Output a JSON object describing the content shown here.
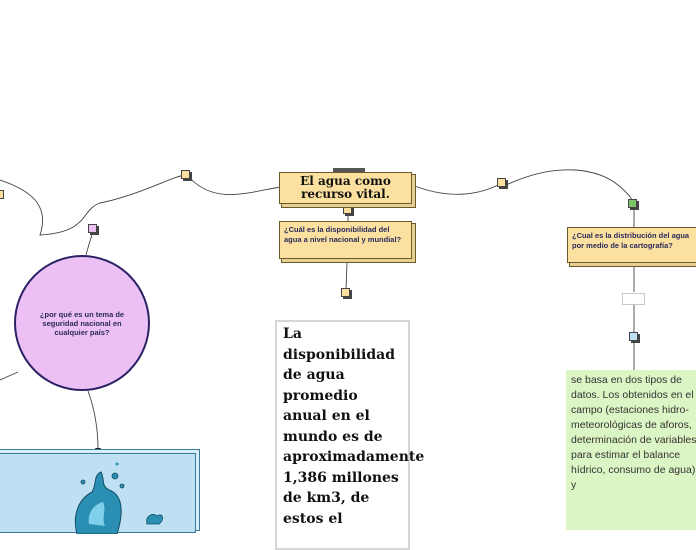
{
  "central_topic": {
    "label": "El agua como recurso vital."
  },
  "question_nodes": {
    "availability": "¿Cuál es la disponibilidad del agua a nivel nacional y mundial?",
    "distribution": "¿Cual es la distribución del agua por medio de la cartografía?",
    "security": "¿por qué es un tema de seguridad nacional en cualquier país?"
  },
  "detail_texts": {
    "availability_answer": "La disponibilidad de agua promedio anual en el mundo es de aproximadamente 1,386 millones de km3, de estos el",
    "distribution_answer": "se basa en dos tipos de datos. Los obtenidos en el campo (estaciones hidro-meteorológicas de aforos, determinación de variables para estimar el balance hídrico, consumo de agua), y"
  },
  "colors": {
    "topic_fill": "#fbe0a0",
    "circle_fill": "#ecc0f5",
    "answer_green": "#dcf5c5",
    "image_fill": "#bfe0f3",
    "connector": "#444444"
  },
  "image": {
    "icon": "water-splash-icon"
  }
}
